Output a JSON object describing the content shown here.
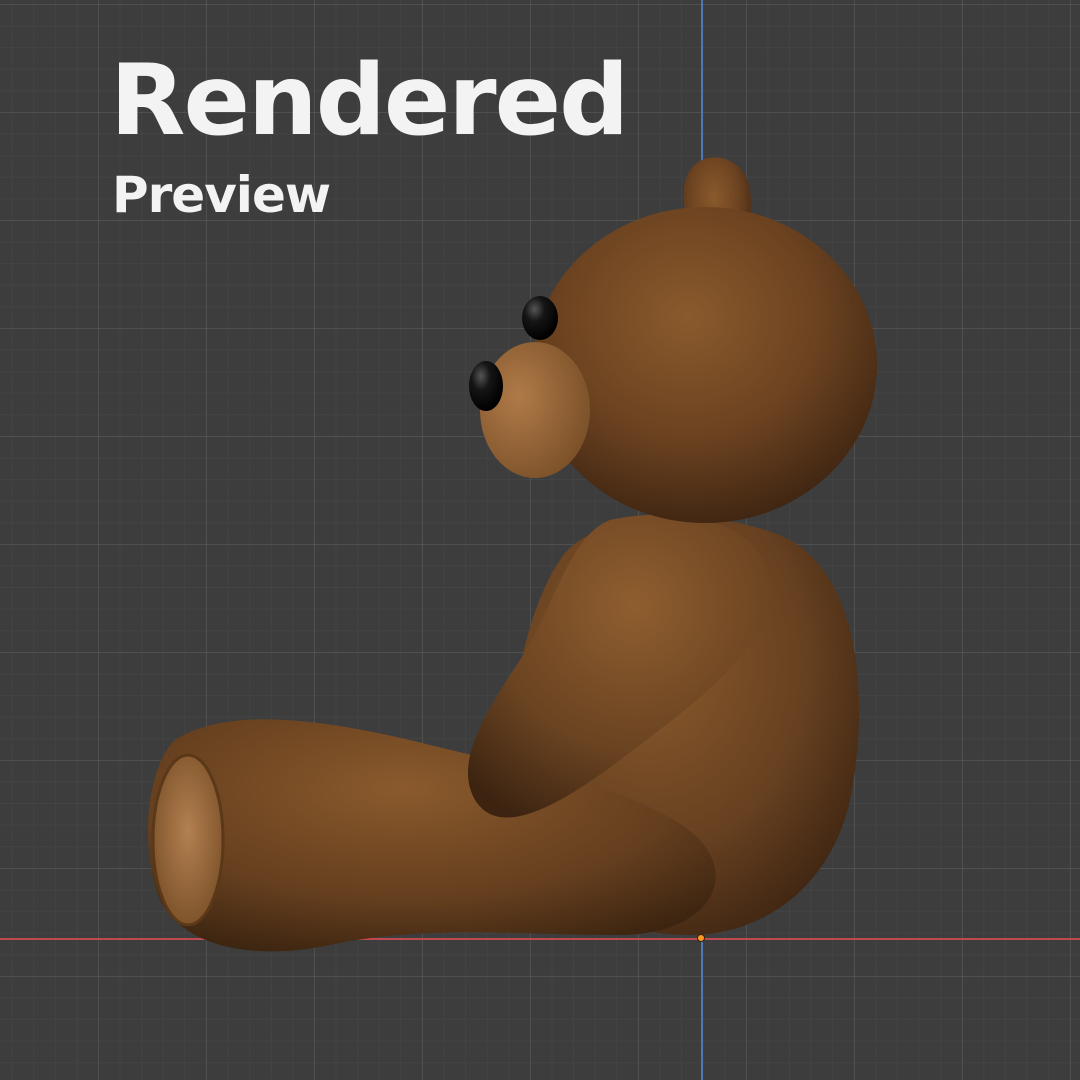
{
  "viewport": {
    "title": "Rendered",
    "subtitle": "Preview"
  },
  "colors": {
    "background": "#3d3d3d",
    "grid": "#5a5a5a",
    "axis_x": "#c0484f",
    "axis_z": "#4a78b8",
    "origin": "#ff9a2a",
    "fur": "#6e4520",
    "muzzle": "#9a6a3e",
    "eye": "#111111"
  },
  "scene": {
    "object": "teddy-bear",
    "view": "side"
  }
}
